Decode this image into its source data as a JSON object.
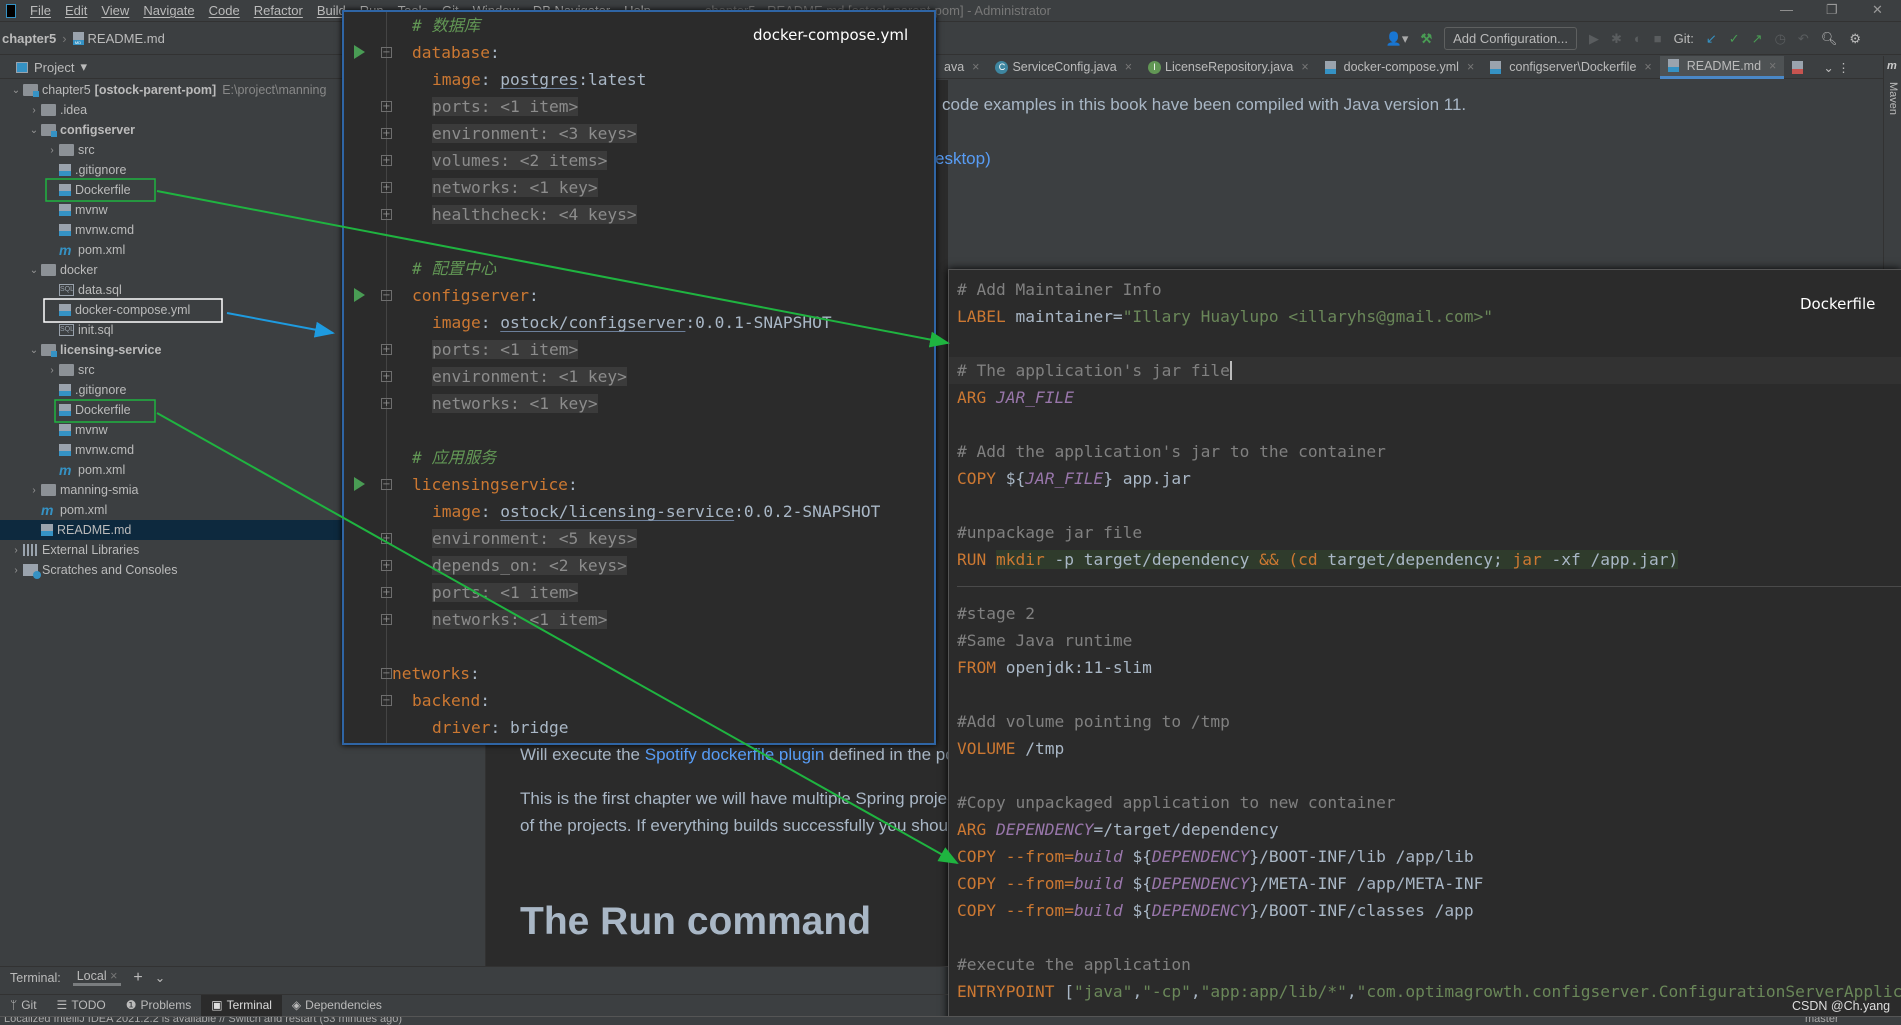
{
  "menu": {
    "items": [
      "File",
      "Edit",
      "View",
      "Navigate",
      "Code",
      "Refactor",
      "Build",
      "Run",
      "Tools",
      "Git",
      "Window",
      "DB Navigator",
      "Help"
    ],
    "title": "chapter5 - README.md [ostock-parent-pom] - Administrator"
  },
  "window": {
    "minimize": "—",
    "restore": "❐",
    "close": "✕"
  },
  "breadcrumb": {
    "project": "chapter5",
    "file": "README.md",
    "file_icon_badge": "MD"
  },
  "toolbar": {
    "add_configuration": "Add Configuration...",
    "git_label": "Git:",
    "user_icon": "user-icon",
    "build_icon": "hammer-icon"
  },
  "project_panel": {
    "title": "Project",
    "dropdown": "▾"
  },
  "tree": [
    {
      "label": "chapter5",
      "suffix": "[ostock-parent-pom]",
      "path": "E:\\project\\manning",
      "level": 0,
      "arrow": "open",
      "icon": "module"
    },
    {
      "label": ".idea",
      "level": 1,
      "arrow": "closed",
      "icon": "folder"
    },
    {
      "label": "configserver",
      "level": 1,
      "arrow": "open",
      "icon": "module",
      "bold": true
    },
    {
      "label": "src",
      "level": 2,
      "arrow": "closed",
      "icon": "folder"
    },
    {
      "label": ".gitignore",
      "level": 2,
      "icon": "file"
    },
    {
      "label": "Dockerfile",
      "level": 2,
      "icon": "file"
    },
    {
      "label": "mvnw",
      "level": 2,
      "icon": "file"
    },
    {
      "label": "mvnw.cmd",
      "level": 2,
      "icon": "file"
    },
    {
      "label": "pom.xml",
      "level": 2,
      "icon": "maven"
    },
    {
      "label": "docker",
      "level": 1,
      "arrow": "open",
      "icon": "folder"
    },
    {
      "label": "data.sql",
      "level": 2,
      "icon": "sql"
    },
    {
      "label": "docker-compose.yml",
      "level": 2,
      "icon": "file"
    },
    {
      "label": "init.sql",
      "level": 2,
      "icon": "sql"
    },
    {
      "label": "licensing-service",
      "level": 1,
      "arrow": "open",
      "icon": "module",
      "bold": true
    },
    {
      "label": "src",
      "level": 2,
      "arrow": "closed",
      "icon": "folder"
    },
    {
      "label": ".gitignore",
      "level": 2,
      "icon": "file"
    },
    {
      "label": "Dockerfile",
      "level": 2,
      "icon": "file"
    },
    {
      "label": "mvnw",
      "level": 2,
      "icon": "file"
    },
    {
      "label": "mvnw.cmd",
      "level": 2,
      "icon": "file"
    },
    {
      "label": "pom.xml",
      "level": 2,
      "icon": "maven"
    },
    {
      "label": "manning-smia",
      "level": 1,
      "arrow": "closed",
      "icon": "folder"
    },
    {
      "label": "pom.xml",
      "level": 1,
      "icon": "maven"
    },
    {
      "label": "README.md",
      "level": 1,
      "icon": "file",
      "selected": true
    },
    {
      "label": "External Libraries",
      "level": 0,
      "arrow": "closed",
      "icon": "lib"
    },
    {
      "label": "Scratches and Consoles",
      "level": 0,
      "arrow": "closed",
      "icon": "scratch"
    }
  ],
  "tabs": [
    {
      "label": "ava",
      "icon": "java"
    },
    {
      "label": "ServiceConfig.java",
      "icon": "class",
      "badge": "C"
    },
    {
      "label": "LicenseRepository.java",
      "icon": "interface",
      "badge": "I"
    },
    {
      "label": "docker-compose.yml",
      "icon": "file"
    },
    {
      "label": "configserver\\Dockerfile",
      "icon": "file"
    },
    {
      "label": "README.md",
      "icon": "file",
      "active": true
    },
    {
      "label": "",
      "icon": "yml"
    }
  ],
  "maven_label": "Maven",
  "readme": {
    "line1": "code examples in this book have been compiled with Java version 11.",
    "line2": "esktop)",
    "p1_pre": "Will execute the ",
    "p1_link": "Spotify dockerfile plugin",
    "p1_post": " defined in the pc",
    "p2a": "This is the first chapter we will have multiple Spring projec",
    "p2b": "of the projects. If everything builds successfully you shou",
    "heading": "The Run command"
  },
  "compose": {
    "label": "docker-compose.yml",
    "lines": [
      {
        "indent": 1,
        "tokens": [
          [
            "cc",
            "# 数据库"
          ]
        ]
      },
      {
        "indent": 1,
        "run": true,
        "fold": "−",
        "tokens": [
          [
            "k",
            "database"
          ],
          [
            "t",
            ":"
          ]
        ]
      },
      {
        "indent": 2,
        "tokens": [
          [
            "k",
            "image"
          ],
          [
            "t",
            ": "
          ],
          [
            "u",
            "postgres"
          ],
          [
            "t",
            ":latest"
          ]
        ]
      },
      {
        "indent": 2,
        "fold": "+",
        "tokens": [
          [
            "f",
            "ports: <1 item>"
          ]
        ]
      },
      {
        "indent": 2,
        "fold": "+",
        "tokens": [
          [
            "f",
            "environment: <3 keys>"
          ]
        ]
      },
      {
        "indent": 2,
        "fold": "+",
        "tokens": [
          [
            "f",
            "volumes: <2 items>"
          ]
        ]
      },
      {
        "indent": 2,
        "fold": "+",
        "tokens": [
          [
            "f",
            "networks: <1 key>"
          ]
        ]
      },
      {
        "indent": 2,
        "fold": "+",
        "tokens": [
          [
            "f",
            "healthcheck: <4 keys>"
          ]
        ]
      },
      {
        "indent": 0,
        "tokens": []
      },
      {
        "indent": 1,
        "tokens": [
          [
            "cc",
            "# 配置中心"
          ]
        ]
      },
      {
        "indent": 1,
        "run": true,
        "fold": "−",
        "tokens": [
          [
            "k",
            "configserver"
          ],
          [
            "t",
            ":"
          ]
        ]
      },
      {
        "indent": 2,
        "tokens": [
          [
            "k",
            "image"
          ],
          [
            "t",
            ": "
          ],
          [
            "u",
            "ostock/configserver"
          ],
          [
            "t",
            ":0.0.1-SNAPSHOT"
          ]
        ]
      },
      {
        "indent": 2,
        "fold": "+",
        "tokens": [
          [
            "f",
            "ports: <1 item>"
          ]
        ]
      },
      {
        "indent": 2,
        "fold": "+",
        "tokens": [
          [
            "f",
            "environment: <1 key>"
          ]
        ]
      },
      {
        "indent": 2,
        "fold": "+",
        "tokens": [
          [
            "f",
            "networks: <1 key>"
          ]
        ]
      },
      {
        "indent": 0,
        "tokens": []
      },
      {
        "indent": 1,
        "tokens": [
          [
            "cc",
            "# 应用服务"
          ]
        ]
      },
      {
        "indent": 1,
        "run": true,
        "fold": "−",
        "tokens": [
          [
            "k",
            "licensingservice"
          ],
          [
            "t",
            ":"
          ]
        ]
      },
      {
        "indent": 2,
        "tokens": [
          [
            "k",
            "image"
          ],
          [
            "t",
            ": "
          ],
          [
            "u",
            "ostock/licensing-service"
          ],
          [
            "t",
            ":0.0.2-SNAPSHOT"
          ]
        ]
      },
      {
        "indent": 2,
        "fold": "+",
        "tokens": [
          [
            "f",
            "environment: <5 keys>"
          ]
        ]
      },
      {
        "indent": 2,
        "fold": "+",
        "tokens": [
          [
            "f",
            "depends_on: <2 keys>"
          ]
        ]
      },
      {
        "indent": 2,
        "fold": "+",
        "tokens": [
          [
            "f",
            "ports: <1 item>"
          ]
        ]
      },
      {
        "indent": 2,
        "fold": "+",
        "tokens": [
          [
            "f",
            "networks: <1 item>"
          ]
        ]
      },
      {
        "indent": 0,
        "tokens": []
      },
      {
        "indent": 0,
        "fold": "−",
        "tokens": [
          [
            "k",
            "networks"
          ],
          [
            "t",
            ":"
          ]
        ]
      },
      {
        "indent": 1,
        "fold": "−",
        "tokens": [
          [
            "k",
            "backend"
          ],
          [
            "t",
            ":"
          ]
        ]
      },
      {
        "indent": 2,
        "tokens": [
          [
            "k",
            "driver"
          ],
          [
            "t",
            ": bridge"
          ]
        ]
      }
    ]
  },
  "dockerfile": {
    "label": "Dockerfile",
    "lines": [
      {
        "tokens": [
          [
            "c",
            "# Add Maintainer Info"
          ]
        ]
      },
      {
        "tokens": [
          [
            "k",
            "LABEL"
          ],
          [
            "t",
            " maintainer="
          ],
          [
            "s",
            "\"Illary Huaylupo <illaryhs@gmail.com>\""
          ]
        ]
      },
      {
        "tokens": []
      },
      {
        "current": true,
        "tokens": [
          [
            "c",
            "# The application's jar file"
          ]
        ]
      },
      {
        "tokens": [
          [
            "k",
            "ARG "
          ],
          [
            "v",
            "JAR_FILE"
          ]
        ]
      },
      {
        "tokens": []
      },
      {
        "tokens": [
          [
            "c",
            "# Add the application's jar to the container"
          ]
        ]
      },
      {
        "tokens": [
          [
            "k",
            "COPY "
          ],
          [
            "t",
            "${"
          ],
          [
            "v",
            "JAR_FILE"
          ],
          [
            "t",
            "} app.jar"
          ]
        ]
      },
      {
        "tokens": []
      },
      {
        "tokens": [
          [
            "c",
            "#unpackage jar file"
          ]
        ]
      },
      {
        "tokens": [
          [
            "k",
            "RUN "
          ],
          [
            "k emb",
            "mkdir"
          ],
          [
            "t emb",
            " -p target/dependency "
          ],
          [
            "k emb",
            "&&"
          ],
          [
            "t emb",
            " "
          ],
          [
            "k emb",
            "(cd"
          ],
          [
            "t emb",
            " target/dependency; "
          ],
          [
            "k emb",
            "jar"
          ],
          [
            "t emb",
            " -xf /app.jar)"
          ]
        ]
      },
      {
        "tokens": [],
        "separator": true
      },
      {
        "tokens": [
          [
            "c",
            "#stage 2"
          ]
        ]
      },
      {
        "tokens": [
          [
            "c",
            "#Same Java runtime"
          ]
        ]
      },
      {
        "tokens": [
          [
            "k",
            "FROM "
          ],
          [
            "t",
            "openjdk:11-slim"
          ]
        ]
      },
      {
        "tokens": []
      },
      {
        "tokens": [
          [
            "c",
            "#Add volume pointing to /tmp"
          ]
        ]
      },
      {
        "tokens": [
          [
            "k",
            "VOLUME "
          ],
          [
            "t",
            "/tmp"
          ]
        ]
      },
      {
        "tokens": []
      },
      {
        "tokens": [
          [
            "c",
            "#Copy unpackaged application to new container"
          ]
        ]
      },
      {
        "tokens": [
          [
            "k",
            "ARG "
          ],
          [
            "v",
            "DEPENDENCY"
          ],
          [
            "t",
            "=/target/dependency"
          ]
        ]
      },
      {
        "tokens": [
          [
            "k",
            "COPY "
          ],
          [
            "k",
            "--from="
          ],
          [
            "v",
            "build"
          ],
          [
            "t",
            " ${"
          ],
          [
            "v",
            "DEPENDENCY"
          ],
          [
            "t",
            "}/BOOT-INF/lib /app/lib"
          ]
        ]
      },
      {
        "tokens": [
          [
            "k",
            "COPY "
          ],
          [
            "k",
            "--from="
          ],
          [
            "v",
            "build"
          ],
          [
            "t",
            " ${"
          ],
          [
            "v",
            "DEPENDENCY"
          ],
          [
            "t",
            "}/META-INF /app/META-INF"
          ]
        ]
      },
      {
        "tokens": [
          [
            "k",
            "COPY "
          ],
          [
            "k",
            "--from="
          ],
          [
            "v",
            "build"
          ],
          [
            "t",
            " ${"
          ],
          [
            "v",
            "DEPENDENCY"
          ],
          [
            "t",
            "}/BOOT-INF/classes /app"
          ]
        ]
      },
      {
        "tokens": []
      },
      {
        "tokens": [
          [
            "c",
            "#execute the application"
          ]
        ]
      },
      {
        "tokens": [
          [
            "k",
            "ENTRYPOINT "
          ],
          [
            "t",
            "["
          ],
          [
            "s",
            "\"java\""
          ],
          [
            "t",
            ","
          ],
          [
            "s",
            "\"-cp\""
          ],
          [
            "t",
            ","
          ],
          [
            "s",
            "\"app:app/lib/*\""
          ],
          [
            "t",
            ","
          ],
          [
            "s",
            "\"com.optimagrowth.configserver.ConfigurationServerApplication\""
          ],
          [
            "t",
            "]"
          ]
        ]
      }
    ]
  },
  "terminal": {
    "label": "Terminal:",
    "tab": "Local",
    "close": "×",
    "add": "+",
    "more": "⌄"
  },
  "toolwindows": [
    {
      "label": "Git",
      "icon": "git-icon"
    },
    {
      "label": "TODO",
      "icon": "list-icon"
    },
    {
      "label": "Problems",
      "icon": "problems-icon"
    },
    {
      "label": "Terminal",
      "icon": "terminal-icon",
      "active": true
    },
    {
      "label": "Dependencies",
      "icon": "dependencies-icon"
    }
  ],
  "status": {
    "message": "Localized IntelliJ IDEA 2021.2.2 is available // Switch and restart (53 minutes ago)",
    "branch": "master"
  },
  "watermark": "CSDN @Ch.yang",
  "colors": {
    "keyword": "#cc7832",
    "string": "#6a8759",
    "comment": "#808080",
    "variable": "#9876aa",
    "text": "#a9b7c6",
    "editor_bg": "#2b2b2b",
    "panel_bg": "#3c3f41",
    "annotation_green": "#1fb440",
    "annotation_blue": "#1e9be0"
  }
}
